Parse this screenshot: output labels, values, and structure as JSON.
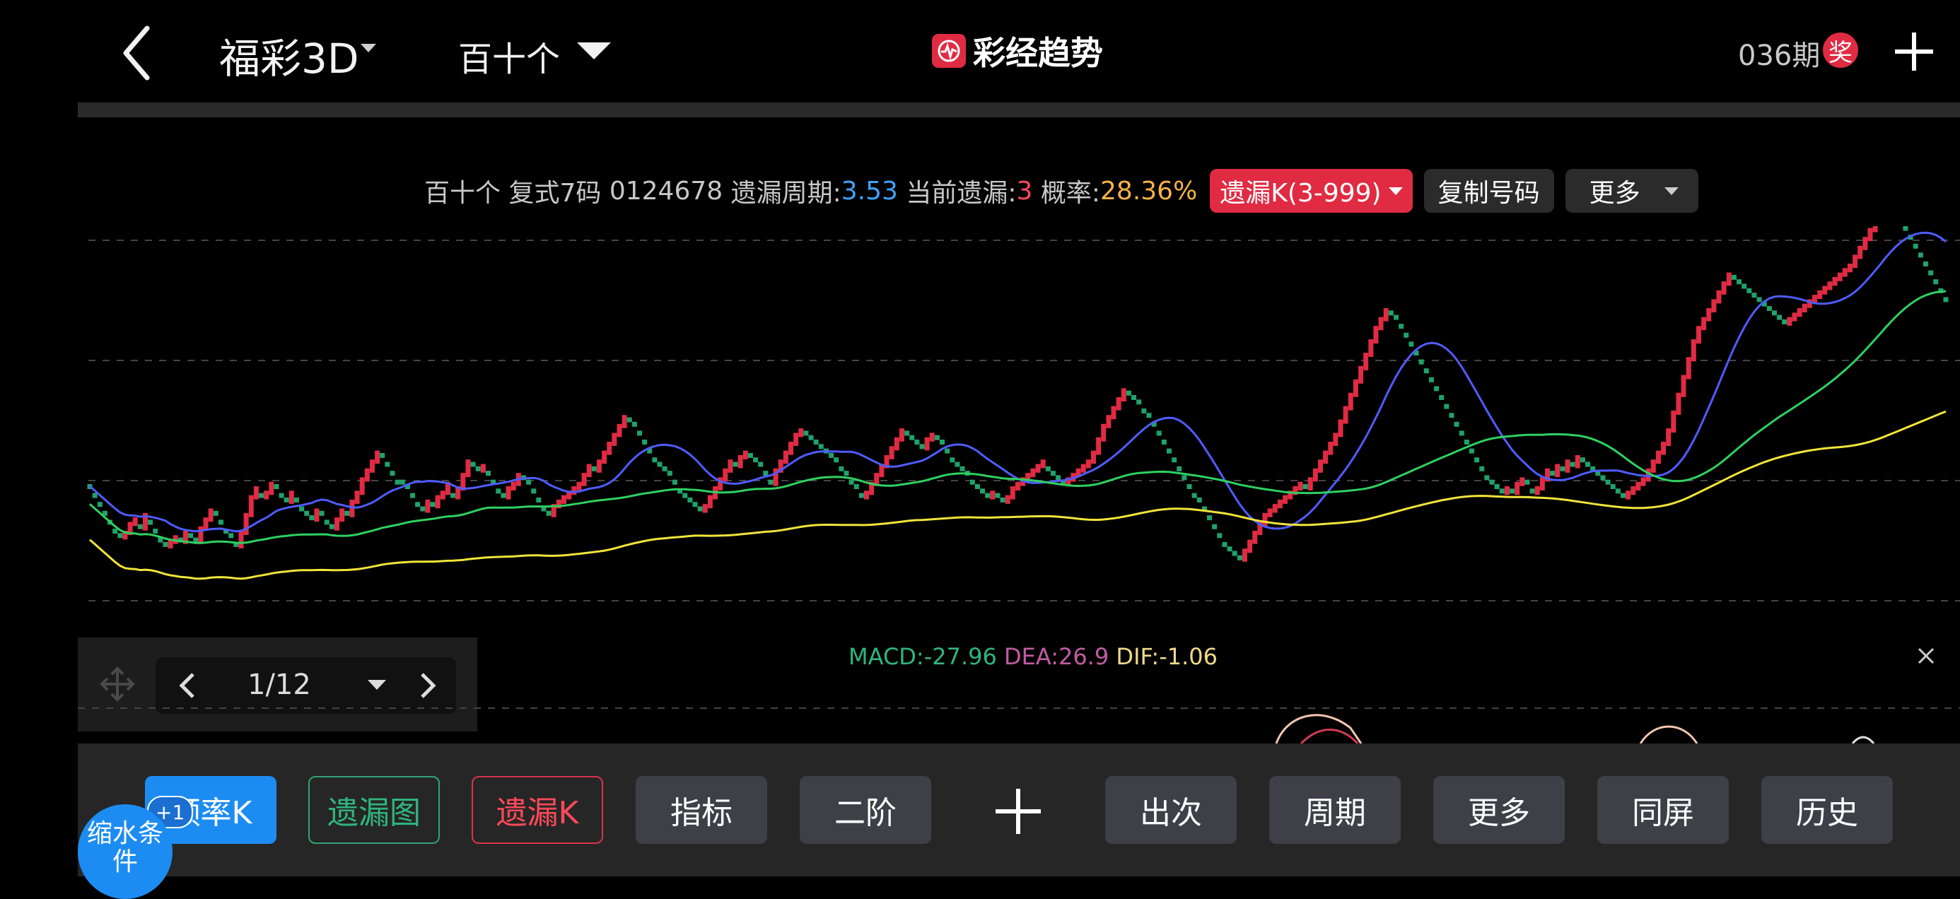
{
  "header": {
    "lottery_name": "福彩3D",
    "position_name": "百十个",
    "brand": "彩经趋势",
    "period": "036期",
    "award_badge": "奖"
  },
  "info_bar": {
    "position": "百十个",
    "mode": "复式7码",
    "numbers": "0124678",
    "cycle_label": "遗漏周期:",
    "cycle_value": "3.53",
    "current_label": "当前遗漏:",
    "current_value": "3",
    "prob_label": "概率:",
    "prob_value": "28.36%",
    "yilou_k_pill": "遗漏K(3-999)",
    "copy_button": "复制号码",
    "more_button": "更多"
  },
  "colors": {
    "up_candle": "#e02b43",
    "down_candle": "#1fa36b",
    "ma_blue": "#4f5cff",
    "ma_green": "#2ed160",
    "ma_yellow": "#f2e43a",
    "brand_red": "#e02b43",
    "accent_blue": "#1d8cf2"
  },
  "pager": {
    "label": "1/12"
  },
  "macd": {
    "macd_text": "MACD:-27.96",
    "dea_text": "DEA:26.9",
    "dif_text": "DIF:-1.06"
  },
  "toolbar": {
    "badge": "+1",
    "freq_k": "频率K",
    "yilou_map": "遗漏图",
    "yilou_k": "遗漏K",
    "indicator": "指标",
    "second_order": "二阶",
    "occurrences": "出次",
    "cycle": "周期",
    "more": "更多",
    "same_screen": "同屏",
    "history": "历史",
    "shrink": "缩水条件"
  },
  "chart_data": {
    "type": "line",
    "title": "",
    "description_series": [
      {
        "name": "K",
        "values": [
          0,
          -2,
          -4,
          -6,
          -8,
          -10,
          -11,
          -10,
          -8,
          -7,
          -9,
          -6,
          -8,
          -10,
          -12,
          -13,
          -12,
          -11,
          -12,
          -10,
          -11,
          -12,
          -9,
          -7,
          -5,
          -6,
          -8,
          -10,
          -11,
          -13,
          -10,
          -6,
          -2,
          0,
          -2,
          -1,
          1,
          0,
          -2,
          -3,
          -1,
          -3,
          -5,
          -6,
          -7,
          -5,
          -6,
          -8,
          -9,
          -7,
          -5,
          -6,
          -3,
          -1,
          2,
          4,
          6,
          8,
          7,
          5,
          3,
          1,
          1,
          0,
          -2,
          -4,
          -5,
          -3,
          -4,
          -2,
          -1,
          1,
          -2,
          0,
          3,
          6,
          5,
          4,
          5,
          3,
          1,
          -1,
          -2,
          0,
          1,
          3,
          2,
          1,
          -1,
          -3,
          -5,
          -6,
          -4,
          -3,
          -2,
          -1,
          0,
          1,
          3,
          5,
          4,
          6,
          8,
          10,
          12,
          14,
          16,
          15,
          14,
          12,
          10,
          8,
          6,
          5,
          4,
          3,
          1,
          -1,
          -2,
          -3,
          -4,
          -5,
          -4,
          -2,
          0,
          2,
          4,
          6,
          5,
          7,
          8,
          7,
          6,
          5,
          3,
          1,
          4,
          6,
          8,
          10,
          12,
          13,
          12,
          11,
          10,
          9,
          8,
          7,
          6,
          4,
          3,
          1,
          0,
          -2,
          -1,
          1,
          3,
          5,
          7,
          9,
          11,
          13,
          12,
          11,
          10,
          9,
          11,
          12,
          11,
          10,
          8,
          6,
          5,
          4,
          3,
          1,
          0,
          -1,
          -2,
          -1,
          -2,
          -3,
          -2,
          0,
          1,
          2,
          3,
          4,
          5,
          6,
          4,
          3,
          2,
          1,
          2,
          3,
          4,
          5,
          6,
          8,
          11,
          14,
          16,
          18,
          20,
          22,
          21,
          20,
          19,
          17,
          16,
          14,
          12,
          10,
          8,
          6,
          4,
          2,
          0,
          -2,
          -3,
          -5,
          -7,
          -9,
          -11,
          -13,
          -14,
          -15,
          -16,
          -14,
          -12,
          -10,
          -8,
          -6,
          -5,
          -4,
          -3,
          -2,
          -1,
          0,
          1,
          0,
          2,
          4,
          6,
          8,
          10,
          12,
          15,
          18,
          21,
          24,
          27,
          30,
          33,
          36,
          38,
          40,
          39,
          38,
          36,
          34,
          32,
          30,
          28,
          26,
          24,
          22,
          20,
          18,
          16,
          14,
          12,
          10,
          8,
          6,
          4,
          2,
          1,
          0,
          -1,
          0,
          -1,
          1,
          2,
          1,
          -1,
          0,
          2,
          4,
          3,
          5,
          4,
          6,
          5,
          7,
          6,
          5,
          4,
          3,
          2,
          1,
          0,
          -1,
          -2,
          -1,
          0,
          1,
          2,
          4,
          6,
          8,
          10,
          13,
          17,
          21,
          25,
          29,
          33,
          36,
          38,
          40,
          42,
          44,
          46,
          48,
          47,
          46,
          45,
          44,
          43,
          42,
          41,
          40,
          39,
          38,
          37,
          38,
          39,
          40,
          41,
          42,
          43,
          44,
          45,
          46,
          47,
          48,
          49,
          50,
          52,
          54,
          56,
          58,
          60,
          62,
          64,
          63,
          62,
          60,
          58,
          56,
          54,
          52,
          50,
          48,
          46,
          44,
          42
        ]
      }
    ],
    "ma_lines": [
      "blue",
      "green",
      "yellow"
    ],
    "grid": true
  }
}
